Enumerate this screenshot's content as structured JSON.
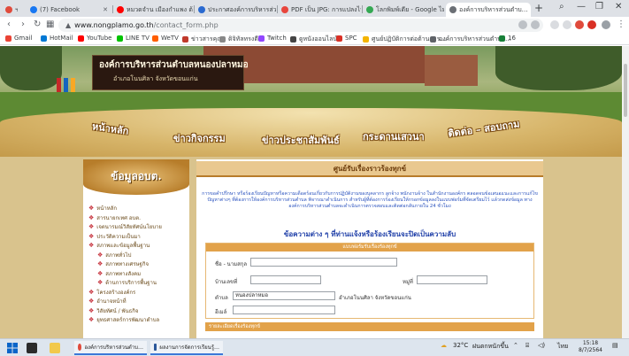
{
  "browser": {
    "tabs": [
      {
        "label": "",
        "favicon_color": "#e04b3c"
      },
      {
        "label": "(7) Facebook",
        "favicon_color": "#1877f2"
      },
      {
        "label": "หมวดจำน เมืองกำแพง ต้นเมล…",
        "favicon_color": "#ff0000"
      },
      {
        "label": "ประกาศองค์การบริหารส่วน…",
        "favicon_color": "#2a6ad0"
      },
      {
        "label": "PDF เป็น JPG: การแปลงไฟ…",
        "favicon_color": "#e8453c"
      },
      {
        "label": "โลกพิมพ์เดีย - Google ไม…",
        "favicon_color": "#34a853"
      },
      {
        "label": "องค์การบริหารส่วนตำบ…",
        "favicon_color": "#6b6f75"
      }
    ],
    "active_tab_index": 6,
    "new_tab": "+",
    "window_controls": {
      "minimize": "—",
      "maximize": "❐",
      "close": "✕",
      "search": "⌕"
    },
    "url": {
      "warning": "Not secure",
      "host": "www.nongplamo.go.th",
      "path": "/contact_form.php"
    },
    "bookmarks": [
      {
        "label": "Gmail",
        "color": "#ea4335"
      },
      {
        "label": "HotMail",
        "color": "#0078d4"
      },
      {
        "label": "YouTube",
        "color": "#ff0000"
      },
      {
        "label": "LINE TV",
        "color": "#00c300"
      },
      {
        "label": "WeTV",
        "color": "#ff5e00"
      },
      {
        "label": "ข่าวสารคุณ",
        "color": "#c0392b"
      },
      {
        "label": "ดิจิทัลทรงตี",
        "color": "#888888"
      },
      {
        "label": "Twitch",
        "color": "#9146ff"
      },
      {
        "label": "ดูหนังออนไลน์",
        "color": "#444444"
      },
      {
        "label": "SPC",
        "color": "#d93025"
      },
      {
        "label": "ศูนย์ปฏิบัติการต่อต้านการ…",
        "color": "#f4b400"
      },
      {
        "label": "องค์การบริหารส่วนตำบล…",
        "color": "#5f6368"
      },
      {
        "label": "16",
        "color": "#188038"
      }
    ]
  },
  "site": {
    "banner_title": "องค์การบริหารส่วนตำบลหนองปลาหมอ",
    "banner_subtitle": "อำเภอโนนศิลา จังหวัดขอนแก่น",
    "nav": [
      "หน้าหลัก",
      "ข่าวกิจกรรม",
      "ข่าวประชาสัมพันธ์",
      "กระดานเสวนา",
      "ติดต่อ – สอบถาม"
    ],
    "sidebar": {
      "title": "ข้อมูลอบต.",
      "items": [
        {
          "label": "หน้าหลัก",
          "sub": false
        },
        {
          "label": "สารนายกเทศ อบต.",
          "sub": false
        },
        {
          "label": "เจตนารมณ์วิสัยทัศน์นโยบาย",
          "sub": false
        },
        {
          "label": "ประวัติความเป็นมา",
          "sub": false
        },
        {
          "label": "สภาพและข้อมูลพื้นฐาน",
          "sub": false
        },
        {
          "label": "สภาพทั่วไป",
          "sub": true
        },
        {
          "label": "สภาพทางเศรษฐกิจ",
          "sub": true
        },
        {
          "label": "สภาพทางสังคม",
          "sub": true
        },
        {
          "label": "ด้านการบริการพื้นฐาน",
          "sub": true
        },
        {
          "label": "โครงสร้างองค์กร",
          "sub": false
        },
        {
          "label": "อำนาจหน้าที่",
          "sub": false
        },
        {
          "label": "วิสัยทัศน์ / พันธกิจ",
          "sub": false
        },
        {
          "label": "ยุทธศาสตร์การพัฒนาตำบล",
          "sub": false
        }
      ]
    },
    "main": {
      "header": "ศูนย์รับเรื่องราวร้องทุกข์",
      "note": "การขอคำปรึกษา หรือร้องเรียนปัญหาหรือความเดือดร้อนเกี่ยวกับการปฏิบัติงานของบุคลากร ลูกจ้าง พนักงานจ้าง ในสำนักงานองค์กร ตลอดจนข้อเสนอแนะและการแก้ไขปัญหาต่างๆ ที่ต้องการให้องค์การบริหารส่วนตำบล พิจารณาดำเนินการ สำหรับผู้ที่ต้องการร้องเรียนให้กรอกข้อมูลลงในแบบฟอร์มที่จัดเตรียมไว้ แล้วกดส่งข้อมูล ทางองค์การบริหารส่วนตำบลจะดำเนินการตรวจสอบและติดต่อกลับภายใน 24 ชั่วโมง",
      "subtitle": "ข้อความต่าง ๆ ที่ท่านแจ้งหรือร้องเรียนจะปิดเป็นความลับ",
      "form": {
        "section_title": "แบบฟอร์มรับเรื่องร้องทุกข์",
        "name_label": "ชื่อ - นามสกุล",
        "house_label": "บ้านเลขที่",
        "moo_label": "หมู่ที่",
        "tambon_label": "ตำบล",
        "tambon_value": "หนองปลาหมอ",
        "district_text": "อำเภอโนนศิลา จังหวัดขอนแก่น",
        "email_label": "อีเมล์",
        "section2_title": "รายละเอียดเรื่องร้องทุกข์"
      }
    }
  },
  "taskbar": {
    "apps": [
      {
        "label": "องค์การบริหารส่วนตำบ…",
        "color": "#e04b3c"
      },
      {
        "label": "ผลงานการจัดการเรียนรู้…",
        "color": "#2b579a"
      }
    ],
    "weather": "32°C",
    "weather_text": "ฝนตกหนักขึ้น",
    "lang": "ไทย",
    "time": "15:18",
    "date": "8/7/2564"
  }
}
